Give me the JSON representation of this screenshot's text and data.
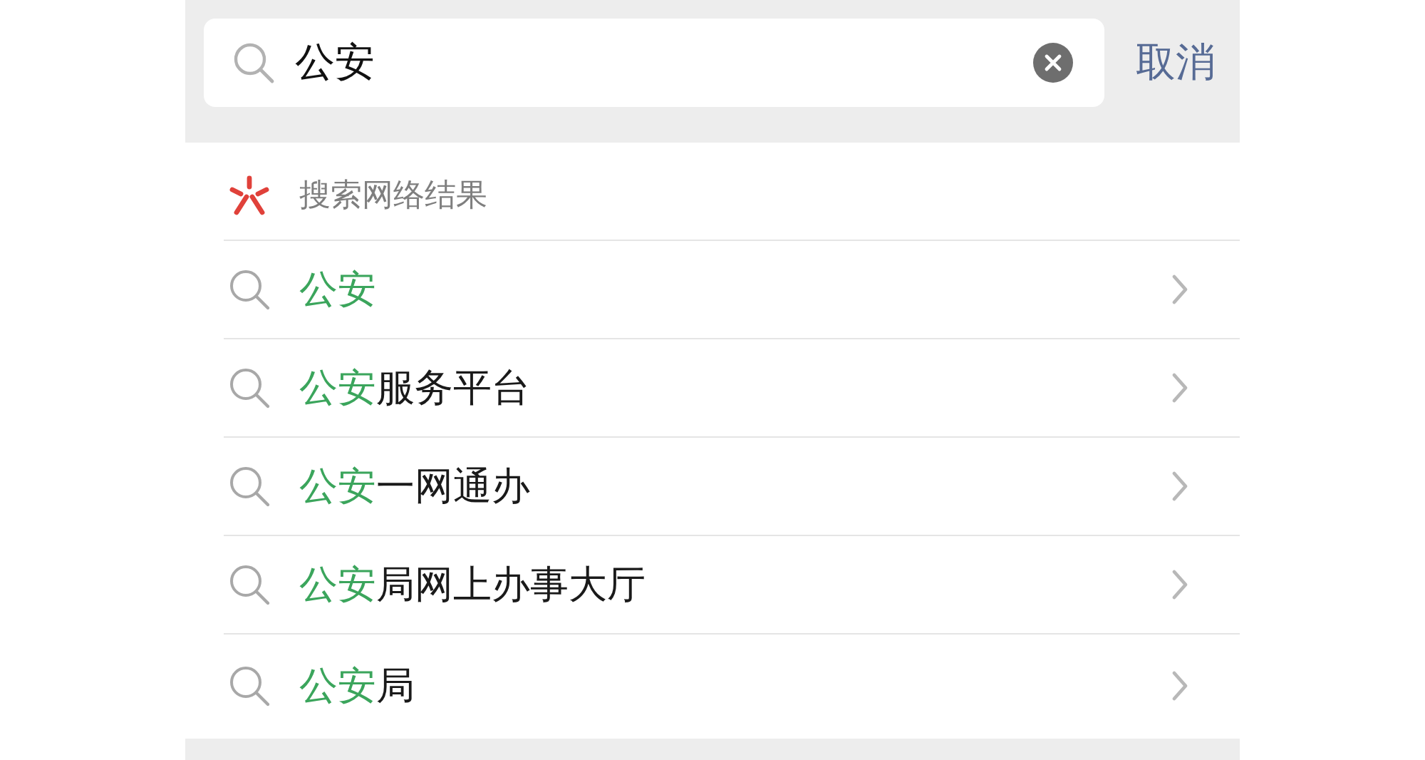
{
  "search": {
    "value": "公安",
    "cancel": "取消"
  },
  "section": {
    "title": "搜索网络结果"
  },
  "suggestions": [
    {
      "highlight": "公安"
    },
    {
      "highlight": "公安",
      "rest": "服务平台"
    },
    {
      "highlight": "公安",
      "rest": "一网通办"
    },
    {
      "highlight": "公安",
      "rest": "局网上办事大厅"
    },
    {
      "highlight": "公安",
      "rest": "局"
    }
  ]
}
